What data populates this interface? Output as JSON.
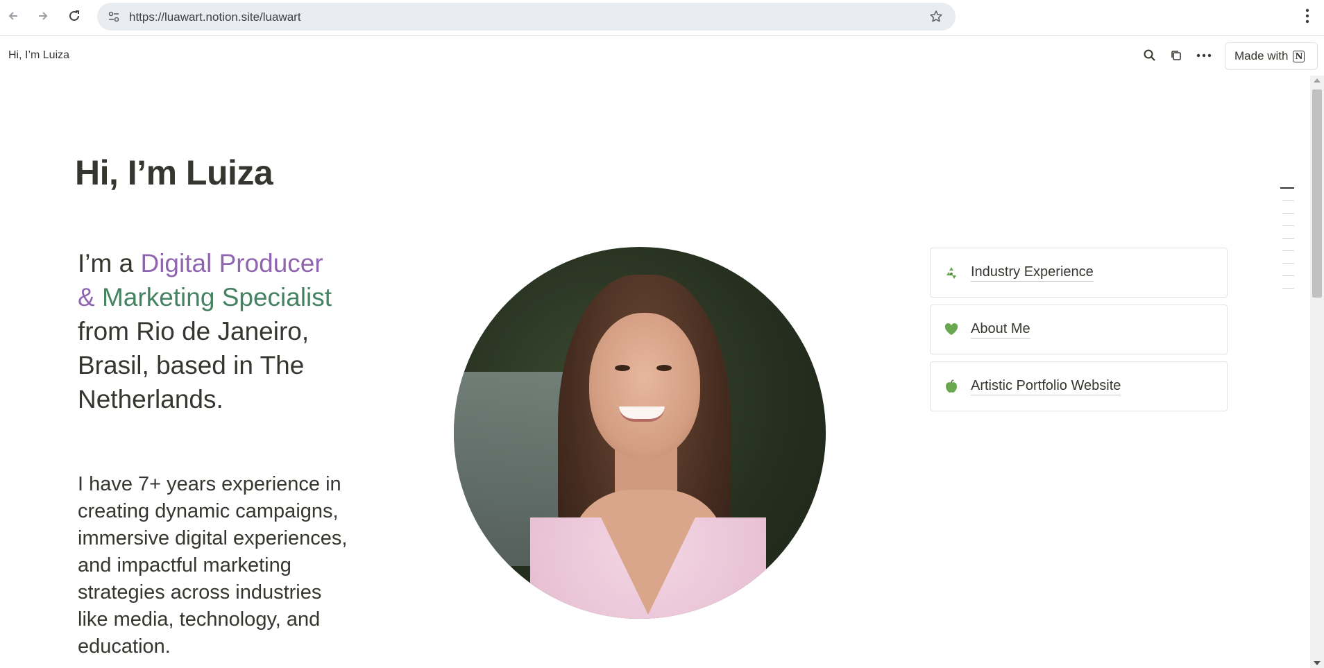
{
  "browser": {
    "url": "https://luawart.notion.site/luawart"
  },
  "notion_bar": {
    "breadcrumb": "Hi, I’m Luiza",
    "made_with_label": "Made with"
  },
  "page": {
    "title": "Hi, I’m Luiza",
    "intro": {
      "prefix": "I’m a ",
      "role_purple": "Digital Producer",
      "role_green_amp": "& ",
      "role_green": "Marketing Specialist",
      "suffix": " from Rio de Janeiro, Brasil, based in The Netherlands."
    },
    "bio": "I have 7+ years experience in creating dynamic campaigns, immersive digital experiences, and impactful marketing strategies across industries like media, technology, and education."
  },
  "links": [
    {
      "label": "Industry Experience",
      "icon": "recycle-icon",
      "color": "#6aa84f"
    },
    {
      "label": "About Me",
      "icon": "green-heart-icon",
      "color": "#6aa84f"
    },
    {
      "label": "Artistic Portfolio Website",
      "icon": "green-apple-icon",
      "color": "#6aa84f"
    }
  ],
  "colors": {
    "purple_text": "#9065b0",
    "green_text": "#448361",
    "body_text": "#37352f"
  }
}
